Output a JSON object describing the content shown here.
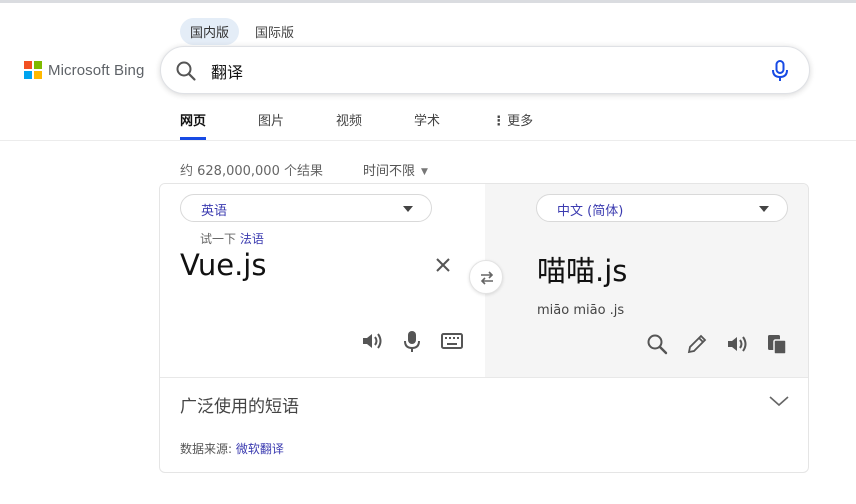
{
  "market_tabs": [
    {
      "label": "国内版",
      "active": true
    },
    {
      "label": "国际版",
      "active": false
    }
  ],
  "logo": {
    "text": "Microsoft Bing",
    "colors": [
      "#f25022",
      "#7fba00",
      "#00a4ef",
      "#ffb900"
    ]
  },
  "search": {
    "value": "翻译",
    "icon": "search-icon",
    "mic_icon": "microphone-icon"
  },
  "scopes": [
    {
      "label": "网页",
      "active": true
    },
    {
      "label": "图片",
      "active": false
    },
    {
      "label": "视频",
      "active": false
    },
    {
      "label": "学术",
      "active": false
    },
    {
      "label": "更多",
      "active": false,
      "prefix": "⋮"
    }
  ],
  "results": {
    "count_text": "约 628,000,000 个结果",
    "time_filter": "时间不限"
  },
  "translator": {
    "source_lang": "英语",
    "target_lang": "中文 (简体)",
    "try_prefix": "试一下",
    "try_link": "法语",
    "source_text": "Vue.js",
    "target_text": "喵喵.js",
    "transliteration": "miāo miāo .js",
    "source_icons": [
      "speaker-icon",
      "microphone-icon",
      "keyboard-icon"
    ],
    "target_icons": [
      "search-icon",
      "pencil-icon",
      "speaker-icon",
      "copy-icon"
    ]
  },
  "phrases": {
    "label": "广泛使用的短语"
  },
  "data_source": {
    "prefix": "数据来源:",
    "link": "微软翻译"
  },
  "accent": "#174ae4",
  "link_color": "#3b3bb0"
}
